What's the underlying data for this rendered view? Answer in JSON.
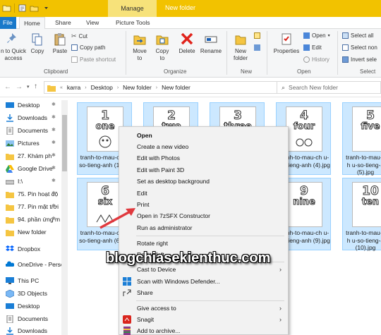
{
  "titlebar": {
    "context_tab": "Manage",
    "title": "New folder"
  },
  "tabs": {
    "file": "File",
    "home": "Home",
    "share": "Share",
    "view": "View",
    "picture_tools": "Picture Tools"
  },
  "ribbon": {
    "clipboard": {
      "pin_line1": "n to Quick",
      "pin_line2": "access",
      "copy": "Copy",
      "paste": "Paste",
      "cut": "Cut",
      "copy_path": "Copy path",
      "paste_shortcut": "Paste shortcut",
      "label": "Clipboard"
    },
    "organize": {
      "move_to": "Move",
      "move_to2": "to",
      "copy_to": "Copy",
      "copy_to2": "to",
      "delete": "Delete",
      "rename": "Rename",
      "label": "Organize"
    },
    "new": {
      "new_folder": "New",
      "new_folder2": "folder",
      "label": "New"
    },
    "open": {
      "properties": "Properties",
      "open": "Open",
      "edit": "Edit",
      "history": "History",
      "label": "Open"
    },
    "select": {
      "select_all": "Select all",
      "select_none": "Select non",
      "invert": "Invert sele",
      "label": "Select"
    }
  },
  "address": {
    "crumbs": [
      "karra",
      "Desktop",
      "New folder",
      "New folder"
    ],
    "search_placeholder": "Search New folder"
  },
  "nav": {
    "items": [
      {
        "label": "Desktop"
      },
      {
        "label": "Downloads"
      },
      {
        "label": "Documents"
      },
      {
        "label": "Pictures"
      },
      {
        "label": "27. Khám ph"
      },
      {
        "label": "Google Drive"
      },
      {
        "label": "I:\\"
      },
      {
        "label": "75. Pin hoạt độ"
      },
      {
        "label": "77. Pin mặt trời"
      },
      {
        "label": "94. phần ứng m"
      },
      {
        "label": "New folder"
      },
      {
        "label": "Dropbox"
      },
      {
        "label": "OneDrive - Perso"
      },
      {
        "label": "This PC"
      },
      {
        "label": "3D Objects"
      },
      {
        "label": "Desktop"
      },
      {
        "label": "Documents"
      },
      {
        "label": "Downloads"
      }
    ]
  },
  "files": [
    {
      "num": "1",
      "word": "one",
      "caption": "tranh-to-mau-ch u-so-tieng-anh (1).jpg"
    },
    {
      "num": "2",
      "word": "two",
      "caption": ""
    },
    {
      "num": "3",
      "word": "three",
      "caption": ""
    },
    {
      "num": "4",
      "word": "four",
      "caption": "tranh-to-mau-ch u-so-tieng-anh (4).jpg"
    },
    {
      "num": "5",
      "word": "five",
      "caption": "tranh-to-mau-ch u-so-tieng-a (5).jpg"
    },
    {
      "num": "6",
      "word": "six",
      "caption": "tranh-to-mau-ch u-so-tieng-anh (6).jpg"
    },
    {
      "num": "9",
      "word": "nine",
      "caption": "tranh-to-mau-ch u-so-tieng-anh (9).jpg"
    },
    {
      "num": "10",
      "word": "ten",
      "caption": "tranh-to-mau-ch u-so-tieng-a (10).jpg"
    }
  ],
  "context_menu": {
    "open": "Open",
    "create_video": "Create a new video",
    "edit_photos": "Edit with Photos",
    "edit_paint3d": "Edit with Paint 3D",
    "set_background": "Set as desktop background",
    "edit": "Edit",
    "print": "Print",
    "open_7z": "Open in 7zSFX Constructor",
    "run_admin": "Run as administrator",
    "rotate_right": "Rotate right",
    "rotate_left": "Rotate left",
    "cast": "Cast to Device",
    "scan": "Scan with Windows Defender...",
    "share": "Share",
    "give_access": "Give access to",
    "snagit": "Snagit",
    "add_archive": "Add to archive..."
  },
  "watermark": "blogchiasekienthuc.com",
  "colors": {
    "accent": "#1979ca",
    "titlebar": "#f2c200",
    "selection": "#cce8ff",
    "watermark_arrow": "#e0393e"
  }
}
